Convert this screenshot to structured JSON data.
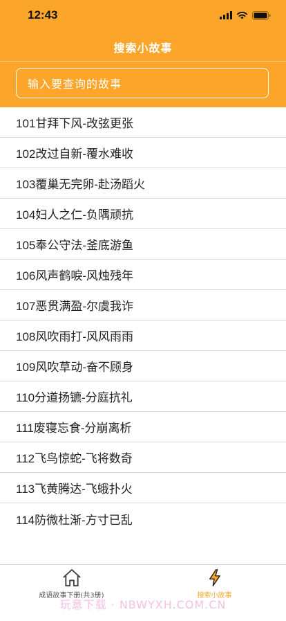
{
  "status_bar": {
    "time": "12:43",
    "icons": [
      "signal-icon",
      "wifi-icon",
      "battery-icon"
    ]
  },
  "nav": {
    "title": "搜索小故事"
  },
  "search": {
    "placeholder": "输入要查询的故事"
  },
  "list": {
    "items": [
      "101甘拜下风-改弦更张",
      "102改过自新-覆水难收",
      "103覆巢无完卵-赴汤蹈火",
      "104妇人之仁-负隅顽抗",
      "105奉公守法-釜底游鱼",
      "106风声鹤唳-风烛残年",
      "107恶贯满盈-尔虞我诈",
      "108风吹雨打-风风雨雨",
      "109风吹草动-奋不顾身",
      "110分道扬镳-分庭抗礼",
      "111废寝忘食-分崩离析",
      "112飞鸟惊蛇-飞将数奇",
      "113飞黄腾达-飞蛾扑火",
      "114防微杜渐-方寸已乱"
    ]
  },
  "tabbar": {
    "tabs": [
      {
        "label": "成语故事下册(共3册)",
        "icon": "home-icon",
        "active": false
      },
      {
        "label": "搜索小故事",
        "icon": "lightning-icon",
        "active": true
      }
    ]
  },
  "watermark": "玩意下载 · NBWYXH.COM.CN",
  "colors": {
    "accent": "#FBA52B",
    "text": "#222222",
    "divider": "#d9d9d9",
    "inactive_tab": "#555555"
  }
}
